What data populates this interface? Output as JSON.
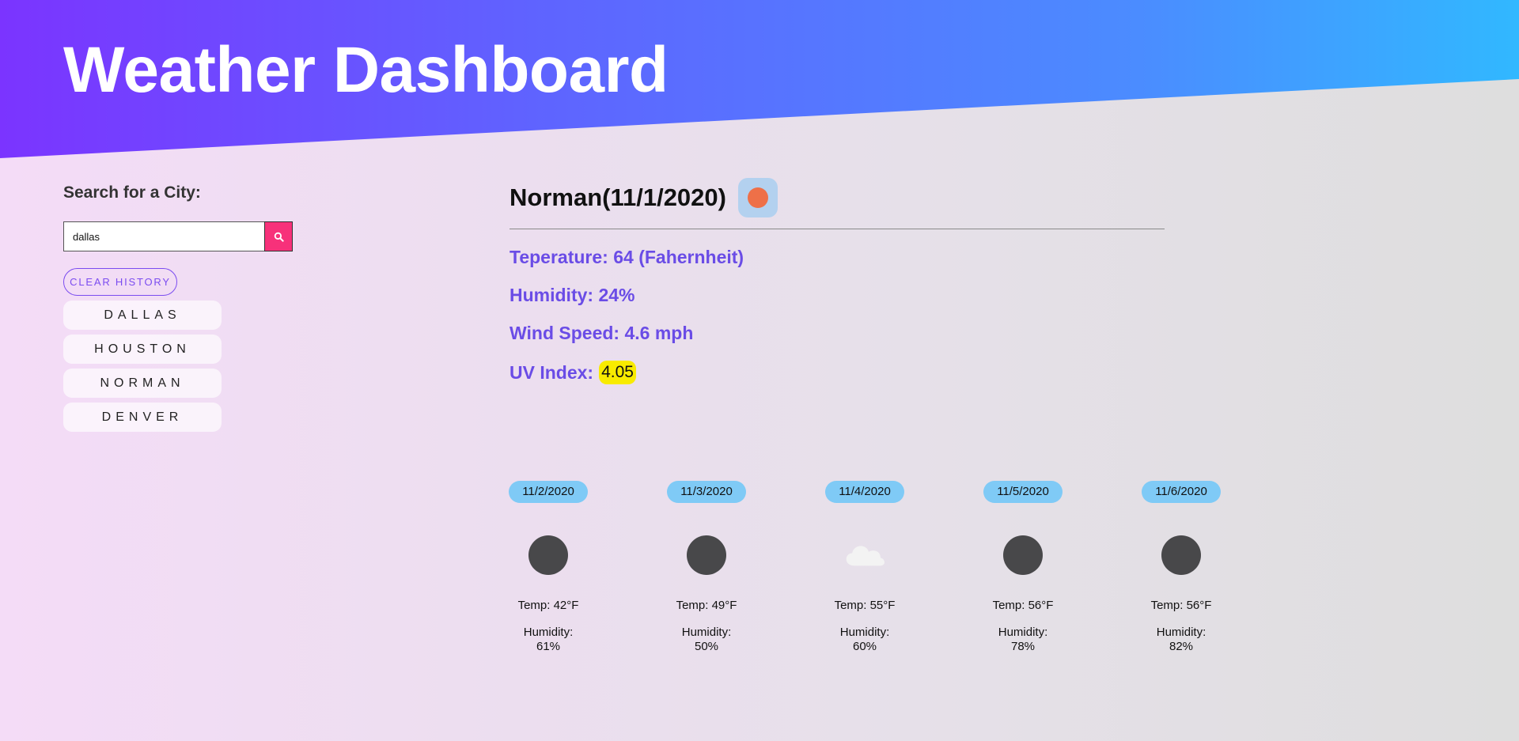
{
  "header": {
    "title": "Weather Dashboard"
  },
  "sidebar": {
    "search_label": "Search for a City:",
    "search_value": "dallas",
    "search_icon": "search-icon",
    "clear_label": "CLEAR HISTORY",
    "history": [
      "DALLAS",
      "HOUSTON",
      "NORMAN",
      "DENVER"
    ]
  },
  "current": {
    "city": "Norman",
    "date": "(11/1/2020)",
    "title": "Norman(11/1/2020)",
    "icon": "sun-icon",
    "temperature": "Teperature: 64 (Fahernheit)",
    "humidity": "Humidity: 24%",
    "wind": "Wind Speed: 4.6 mph",
    "uv_label": "UV Index:",
    "uv_value": "4.05"
  },
  "forecast": [
    {
      "date": "11/2/2020",
      "icon": "moon-icon",
      "temp": "Temp: 42°F",
      "humidity_label": "Humidity:",
      "humidity_value": "61%"
    },
    {
      "date": "11/3/2020",
      "icon": "moon-icon",
      "temp": "Temp: 49°F",
      "humidity_label": "Humidity:",
      "humidity_value": "50%"
    },
    {
      "date": "11/4/2020",
      "icon": "cloud-icon",
      "temp": "Temp: 55°F",
      "humidity_label": "Humidity:",
      "humidity_value": "60%"
    },
    {
      "date": "11/5/2020",
      "icon": "moon-icon",
      "temp": "Temp: 56°F",
      "humidity_label": "Humidity:",
      "humidity_value": "78%"
    },
    {
      "date": "11/6/2020",
      "icon": "moon-icon",
      "temp": "Temp: 56°F",
      "humidity_label": "Humidity:",
      "humidity_value": "82%"
    }
  ],
  "colors": {
    "header_start": "#7b34ff",
    "header_end": "#31b8ff",
    "accent": "#6a4ce6",
    "search_button": "#f7317a",
    "uv_highlight": "#f8eb00",
    "date_pill": "#7fcaf6"
  }
}
